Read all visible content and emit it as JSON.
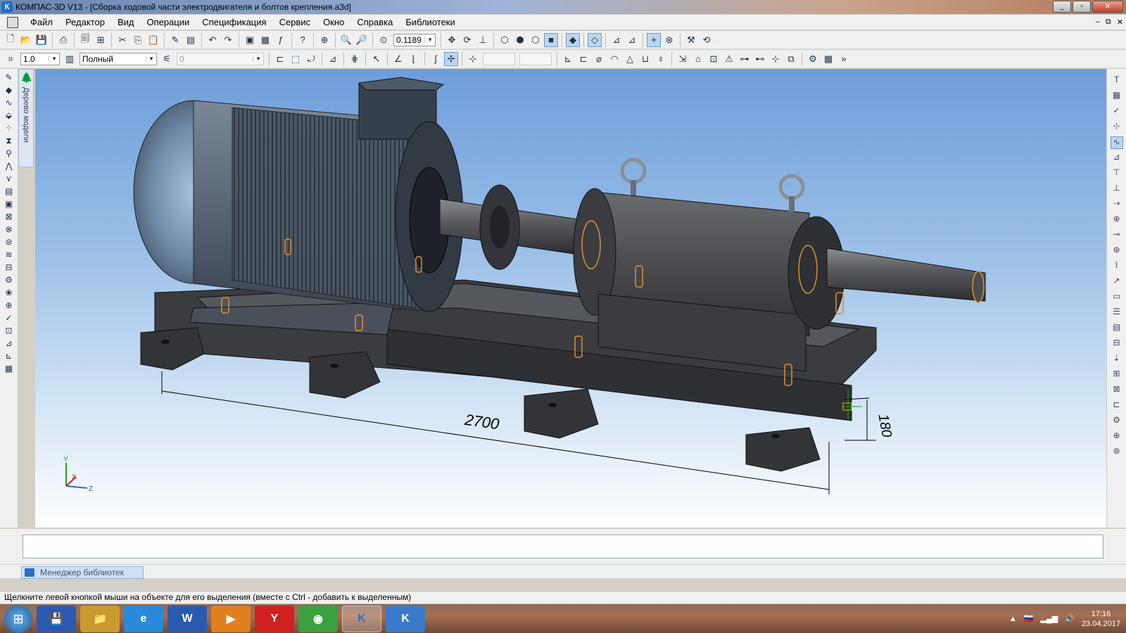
{
  "window": {
    "title": "КОМПАС-3D V13 - [Сборка ходовой части электродвигателя и болтов крепления.a3d]",
    "app_icon": "kompas-icon",
    "controls": [
      "_",
      "▫",
      "✕"
    ]
  },
  "menu": {
    "items": [
      "Файл",
      "Редактор",
      "Вид",
      "Операции",
      "Спецификация",
      "Сервис",
      "Окно",
      "Справка",
      "Библиотеки"
    ],
    "doc_controls": [
      "–",
      "⧉",
      "✕"
    ]
  },
  "toolbar1": {
    "zoom_value": "0.1189"
  },
  "toolbar2": {
    "step_value": "1.0",
    "view_mode": "Полный",
    "layer_value": "0"
  },
  "tree_panel": {
    "label": "Дерево модели"
  },
  "viewport": {
    "dimension_length": "2700",
    "dimension_height": "180",
    "axis_y": "Y",
    "axis_x": "X",
    "axis_z": "Z"
  },
  "library_manager": {
    "tab_label": "Менеджер библиотек"
  },
  "status": {
    "text": "Щелкните левой кнопкой мыши на объекте для его выделения (вместе с Ctrl - добавить к выделенным)"
  },
  "taskbar": {
    "apps": [
      {
        "name": "save-app",
        "label": "💾",
        "color": "#2a5ab0"
      },
      {
        "name": "explorer-app",
        "label": "📁",
        "color": "#c89a30"
      },
      {
        "name": "ie-app",
        "label": "e",
        "color": "#2a8ad8"
      },
      {
        "name": "word-app",
        "label": "W",
        "color": "#2a5ab0"
      },
      {
        "name": "media-app",
        "label": "▶",
        "color": "#e08020"
      },
      {
        "name": "yandex-app",
        "label": "Y",
        "color": "#d02020"
      },
      {
        "name": "chrome-app",
        "label": "◉",
        "color": "#3aa040"
      },
      {
        "name": "kompas-app",
        "label": "K",
        "color": "#2a6fc0"
      },
      {
        "name": "kompas-viewer-app",
        "label": "K",
        "color": "#3a7ac8"
      }
    ],
    "time": "17:16",
    "date": "23.04.2017"
  }
}
